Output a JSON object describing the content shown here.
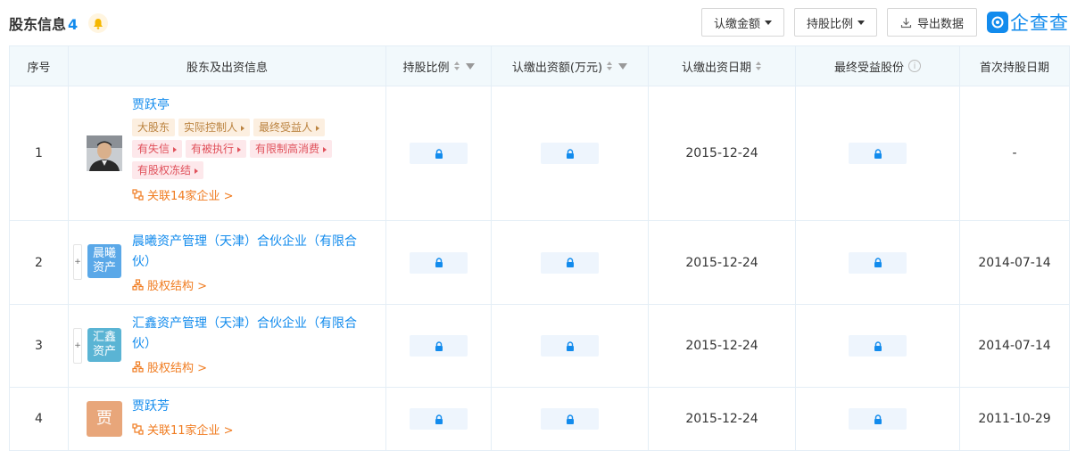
{
  "header": {
    "title": "股东信息",
    "count": "4",
    "buttons": {
      "subscribed_amount": "认缴金额",
      "holding_ratio": "持股比例",
      "export": "导出数据"
    },
    "logo_text": "企查查"
  },
  "table": {
    "columns": [
      "序号",
      "股东及出资信息",
      "持股比例",
      "认缴出资额(万元)",
      "认缴出资日期",
      "最终受益股份",
      "首次持股日期"
    ],
    "rows": [
      {
        "index": "1",
        "name": "贾跃亭",
        "tags": [
          {
            "label": "大股东",
            "style": "orange"
          },
          {
            "label": "实际控制人",
            "style": "orange"
          },
          {
            "label": "最终受益人",
            "style": "orange"
          },
          {
            "label": "有失信",
            "style": "red"
          },
          {
            "label": "有被执行",
            "style": "red"
          },
          {
            "label": "有限制高消费",
            "style": "red"
          },
          {
            "label": "有股权冻结",
            "style": "red"
          }
        ],
        "link": "关联14家企业 >",
        "subscribed_date": "2015-12-24",
        "first_date": "-"
      },
      {
        "index": "2",
        "name": "晨曦资产管理（天津）合伙企业（有限合伙）",
        "avatar_text": "晨曦资产",
        "link": "股权结构 >",
        "subscribed_date": "2015-12-24",
        "first_date": "2014-07-14"
      },
      {
        "index": "3",
        "name": "汇鑫资产管理（天津）合伙企业（有限合伙）",
        "avatar_text": "汇鑫资产",
        "link": "股权结构 >",
        "subscribed_date": "2015-12-24",
        "first_date": "2014-07-14"
      },
      {
        "index": "4",
        "name": "贾跃芳",
        "avatar_text": "贾",
        "link": "关联11家企业 >",
        "subscribed_date": "2015-12-24",
        "first_date": "2011-10-29"
      }
    ]
  },
  "colors": {
    "accent": "#128bed",
    "orange_link": "#f07c21",
    "header_bg": "#f2f9fc"
  }
}
